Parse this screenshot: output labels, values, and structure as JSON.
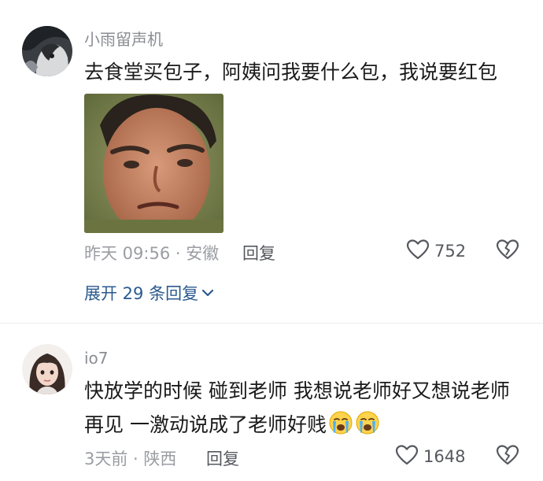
{
  "comments": [
    {
      "username": "小雨留声机",
      "text": "去食堂买包子，阿姨问我要什么包，我说要红包",
      "time_location": "昨天 09:56 · 安徽",
      "reply_label": "回复",
      "like_count": "752",
      "expand_replies": "展开 29 条回复"
    },
    {
      "username": "io7",
      "text": "快放学的时候  碰到老师  我想说老师好又想说老师再见  一激动说成了老师好贱",
      "time_location": "3天前 · 陕西",
      "reply_label": "回复",
      "like_count": "1648"
    }
  ],
  "icons": {
    "like": "heart-outline-icon",
    "dislike": "broken-heart-icon",
    "expand": "chevron-down-icon",
    "emoji": "crying-face-emoji-icon"
  },
  "colors": {
    "username": "#8a8d93",
    "meta": "#9a9da3",
    "link": "#2b5a8f",
    "action": "#55585e"
  }
}
